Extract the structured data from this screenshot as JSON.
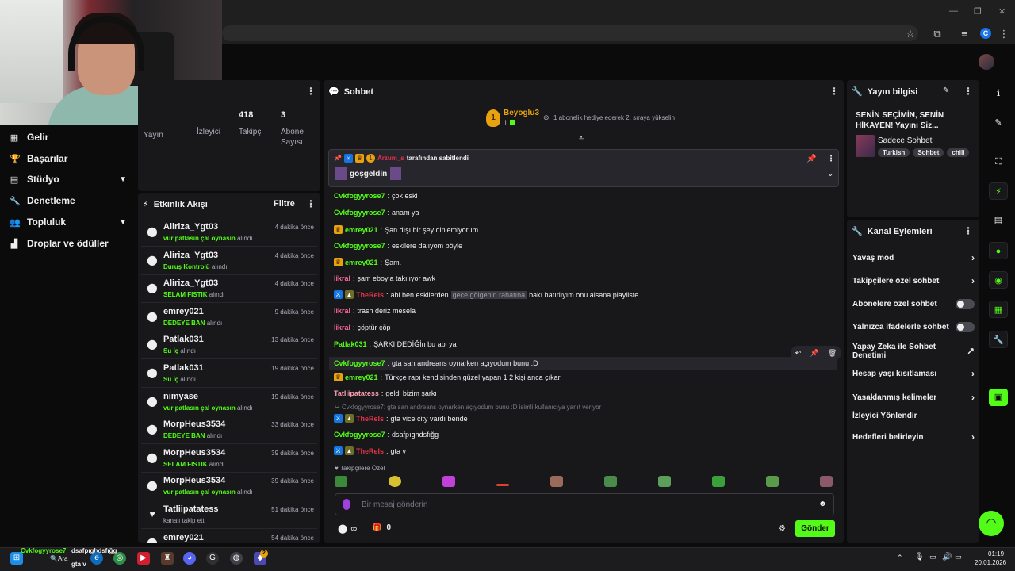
{
  "window": {
    "minimize": "—",
    "restore": "❐",
    "close": "✕"
  },
  "browser": {
    "profile_initial": "C"
  },
  "left_nav": [
    {
      "label": "Gelir",
      "icon": "▦"
    },
    {
      "label": "Başarılar",
      "icon": "🏆"
    },
    {
      "label": "Stüdyo",
      "icon": "▤",
      "chev": "▼"
    },
    {
      "label": "Denetleme",
      "icon": "🔧"
    },
    {
      "label": "Topluluk",
      "icon": "👥",
      "chev": "▼"
    },
    {
      "label": "Droplar ve ödüller",
      "icon": "▟"
    }
  ],
  "stats": {
    "yayin": {
      "label": "Yayın"
    },
    "izleyici": {
      "label": "İzleyici"
    },
    "takipci": {
      "value": "418",
      "label": "Takipçi"
    },
    "abone": {
      "value": "3",
      "label": "Abone Sayısı"
    }
  },
  "activity": {
    "title": "Etkinlik Akışı",
    "filter": "Filtre",
    "items": [
      {
        "name": "Aliriza_Ygt03",
        "reward": "vur patlasın çal oynasın",
        "suffix": "alındı",
        "time": "4 dakika önce",
        "icon": "⬤"
      },
      {
        "name": "Aliriza_Ygt03",
        "reward": "Duruş Kontrolü",
        "suffix": "alındı",
        "time": "4 dakika önce",
        "icon": "⬤"
      },
      {
        "name": "Aliriza_Ygt03",
        "reward": "SELAM FISTIK",
        "suffix": "alındı",
        "time": "4 dakika önce",
        "icon": "⬤"
      },
      {
        "name": "emrey021",
        "reward": "DEDEYE BAN",
        "suffix": "alındı",
        "time": "9 dakika önce",
        "icon": "⬤"
      },
      {
        "name": "Patlak031",
        "reward": "Su İç",
        "suffix": "alındı",
        "time": "13 dakika önce",
        "icon": "⬤"
      },
      {
        "name": "Patlak031",
        "reward": "Su İç",
        "suffix": "alındı",
        "time": "19 dakika önce",
        "icon": "⬤"
      },
      {
        "name": "nimyase",
        "reward": "vur patlasın çal oynasın",
        "suffix": "alındı",
        "time": "19 dakika önce",
        "icon": "⬤"
      },
      {
        "name": "MorpHeus3534",
        "reward": "DEDEYE BAN",
        "suffix": "alındı",
        "time": "33 dakika önce",
        "icon": "⬤"
      },
      {
        "name": "MorpHeus3534",
        "reward": "SELAM FISTIK",
        "suffix": "alındı",
        "time": "39 dakika önce",
        "icon": "⬤"
      },
      {
        "name": "MorpHeus3534",
        "reward": "vur patlasın çal oynasın",
        "suffix": "alındı",
        "time": "39 dakika önce",
        "icon": "⬤"
      },
      {
        "name": "Tatliipatatess",
        "reward": "",
        "suffix": "kanalı takip etti",
        "time": "51 dakika önce",
        "icon": "♥"
      },
      {
        "name": "emrey021",
        "reward": "",
        "suffix": "",
        "time": "54 dakika önce",
        "icon": "⬤"
      }
    ]
  },
  "chat": {
    "title": "Sohbet",
    "gifter_rank": "1",
    "gifter_name": "Beyoglu3",
    "gifter_count": "1",
    "gift_hint": "1 abonelik hediye ederek 2. sıraya yükselin",
    "pinned_by_user": "Arzum_s",
    "pinned_by_text": "tarafından sabitlendi",
    "pinned_message": "goşgeldin",
    "messages": [
      {
        "user": "Cvkfogyyrose7",
        "color": "#53fc18",
        "text": "çok eski",
        "badges": []
      },
      {
        "user": "Cvkfogyyrose7",
        "color": "#53fc18",
        "text": "anam ya",
        "badges": []
      },
      {
        "user": "emrey021",
        "color": "#53fc18",
        "text": "Şan dışı bir şey dinlemiyorum",
        "badges": [
          "crown"
        ]
      },
      {
        "user": "Cvkfogyyrose7",
        "color": "#53fc18",
        "text": "eskilere dalıyom böyle",
        "badges": []
      },
      {
        "user": "emrey021",
        "color": "#53fc18",
        "text": "Şam.",
        "badges": [
          "crown"
        ]
      },
      {
        "user": "likral",
        "color": "#ff6b9a",
        "text": "şam eboyla takılıyor awk",
        "badges": []
      },
      {
        "user": "TheRels",
        "color": "#e5334a",
        "text_before": "abi ben eskilerden",
        "highlight": "gece gölgenin rahatına",
        "text_after": "bakı hatırlıyım onu alsana playliste",
        "badges": [
          "mod",
          "sub"
        ]
      },
      {
        "user": "likral",
        "color": "#ff6b9a",
        "text": "trash deriz mesela",
        "badges": []
      },
      {
        "user": "likral",
        "color": "#ff6b9a",
        "text": "çöptür çöp",
        "badges": []
      },
      {
        "user": "Patlak031",
        "color": "#53fc18",
        "text": "ŞARKI DEDİĞİn bu abi ya",
        "badges": []
      },
      {
        "user": "Cvkfogyyrose7",
        "color": "#53fc18",
        "text": "gta san andreans oynarken açıyodum bunu :D",
        "badges": []
      },
      {
        "user": "emrey021",
        "color": "#53fc18",
        "text": "Türkçe rapı kendisinden güzel yapan 1 2 kişi anca çıkar",
        "badges": [
          "crown"
        ]
      },
      {
        "user": "Tatliipatatess",
        "color": "#ff9fb2",
        "text": "geldi bizim şarkı",
        "badges": []
      },
      {
        "user": "TheRels",
        "color": "#e5334a",
        "text": "gta vice city vardı bende",
        "badges": [
          "mod",
          "sub"
        ]
      },
      {
        "user": "Cvkfogyyrose7",
        "color": "#53fc18",
        "text": "dsafpıghdsfığg",
        "badges": []
      },
      {
        "user": "TheRels",
        "color": "#e5334a",
        "text": "gta v",
        "badges": [
          "mod",
          "sub"
        ]
      }
    ],
    "reply_context": "Cvkfogyyrose7: gta san andreans oynarken açıyodum bunu :D isimli kullanıcıya yanıt veriyor",
    "followers_only": "Takipçilere Özel",
    "input_placeholder": "Bir mesaj gönderin",
    "points_value": "∞",
    "gift_count": "0",
    "send": "Gönder"
  },
  "stream_info": {
    "title": "Yayın bilgisi",
    "stream_title": "SENİN SEÇİMİN, SENİN HİKAYEN! Yayını Siz...",
    "category": "Sadece Sohbet",
    "tags": [
      "Turkish",
      "Sohbet",
      "chill"
    ]
  },
  "channel_actions": {
    "title": "Kanal Eylemleri",
    "items": [
      {
        "label": "Yavaş mod",
        "type": "arrow"
      },
      {
        "label": "Takipçilere özel sohbet",
        "type": "arrow"
      },
      {
        "label": "Abonelere özel sohbet",
        "type": "toggle"
      },
      {
        "label": "Yalnızca ifadelerle sohbet",
        "type": "toggle"
      },
      {
        "label": "Yapay Zeka ile Sohbet Denetimi",
        "type": "external"
      },
      {
        "label": "Hesap yaşı kısıtlaması",
        "type": "arrow"
      },
      {
        "label": "Yasaklanmış kelimeler",
        "type": "arrow"
      },
      {
        "label": "İzleyici Yönlendir",
        "type": "none"
      },
      {
        "label": "Hedefleri belirleyin",
        "type": "arrow"
      }
    ]
  },
  "taskbar": {
    "notif_user": "Cvkfogyyrose7",
    "notif_msg1": "dsafpıghdsfığg",
    "notif_msg2": "gta v",
    "search_label": "Ara",
    "time": "01:19",
    "date": "20.01.2026",
    "badge_count": "2"
  }
}
